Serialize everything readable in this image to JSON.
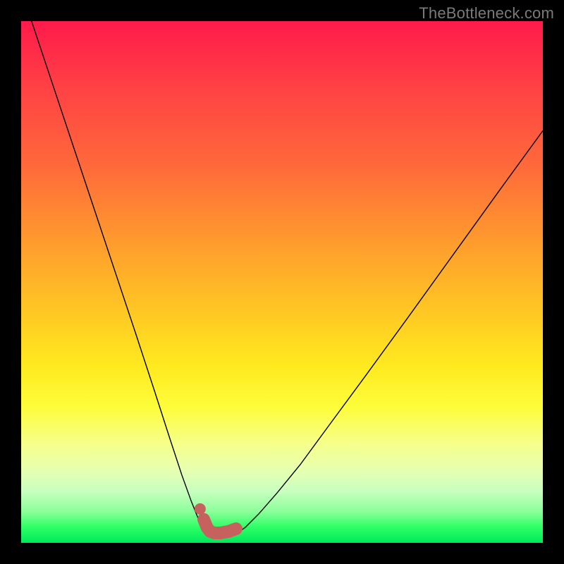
{
  "watermark": "TheBottleneck.com",
  "domain": {
    "xmin": 0,
    "xmax": 1,
    "ymin": 0,
    "ymax": 1
  },
  "chart_data": {
    "type": "line",
    "title": "",
    "xlabel": "",
    "ylabel": "",
    "ylim": [
      0,
      1
    ],
    "series": [
      {
        "name": "left-curve",
        "x": [
          0.02,
          0.06,
          0.1,
          0.14,
          0.18,
          0.22,
          0.256,
          0.285,
          0.308,
          0.326,
          0.34,
          0.35,
          0.36
        ],
        "y": [
          1.0,
          0.88,
          0.76,
          0.64,
          0.52,
          0.4,
          0.29,
          0.2,
          0.13,
          0.08,
          0.045,
          0.025,
          0.017
        ]
      },
      {
        "name": "right-curve",
        "x": [
          0.412,
          0.43,
          0.455,
          0.49,
          0.535,
          0.59,
          0.66,
          0.74,
          0.83,
          0.92,
          1.0
        ],
        "y": [
          0.017,
          0.03,
          0.055,
          0.095,
          0.15,
          0.225,
          0.32,
          0.43,
          0.555,
          0.68,
          0.79
        ]
      },
      {
        "name": "bold-valley",
        "x": [
          0.35,
          0.356,
          0.362,
          0.37,
          0.382,
          0.398,
          0.412
        ],
        "y": [
          0.045,
          0.03,
          0.022,
          0.019,
          0.019,
          0.022,
          0.027
        ]
      }
    ],
    "marker": {
      "name": "pink-dot",
      "x": 0.343,
      "y": 0.065
    },
    "annotations": []
  }
}
